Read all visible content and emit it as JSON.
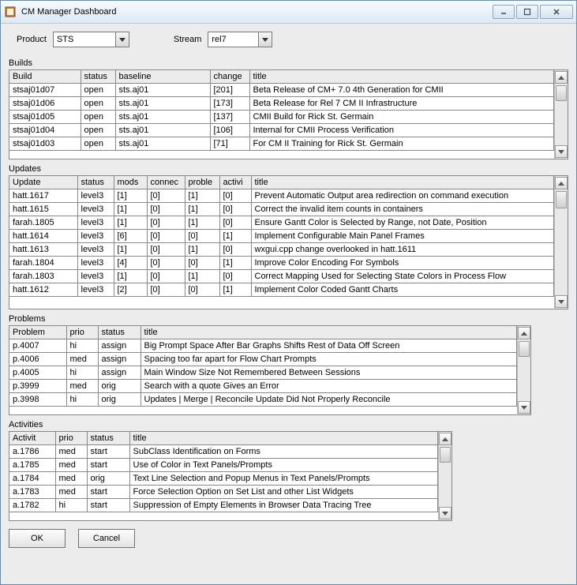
{
  "window": {
    "title": "CM Manager Dashboard"
  },
  "selectors": {
    "product_label": "Product",
    "product_value": "STS",
    "stream_label": "Stream",
    "stream_value": "rel7"
  },
  "builds": {
    "label": "Builds",
    "headers": [
      "Build",
      "status",
      "baseline",
      "change",
      "title"
    ],
    "rows": [
      {
        "c": [
          "stsaj01d07",
          "open",
          "sts.aj01",
          "[201]",
          "Beta Release of CM+ 7.0 4th Generation for CMII"
        ]
      },
      {
        "c": [
          "stsaj01d06",
          "open",
          "sts.aj01",
          "[173]",
          "Beta Release for Rel 7 CM II Infrastructure"
        ]
      },
      {
        "c": [
          "stsaj01d05",
          "open",
          "sts.aj01",
          "[137]",
          "CMII Build for Rick St. Germain"
        ]
      },
      {
        "c": [
          "stsaj01d04",
          "open",
          "sts.aj01",
          "[106]",
          "Internal for CMII Process Verification"
        ]
      },
      {
        "c": [
          "stsaj01d03",
          "open",
          "sts.aj01",
          "[71]",
          "For CM II Training for Rick St. Germain"
        ]
      }
    ]
  },
  "updates": {
    "label": "Updates",
    "headers": [
      "Update",
      "status",
      "mods",
      "connec",
      "proble",
      "activi",
      "title"
    ],
    "rows": [
      {
        "c": [
          "hatt.1617",
          "level3",
          "[1]",
          "[0]",
          "[1]",
          "[0]",
          "Prevent Automatic Output area redirection on command execution"
        ]
      },
      {
        "c": [
          "hatt.1615",
          "level3",
          "[1]",
          "[0]",
          "[1]",
          "[0]",
          "Correct the invalid item counts in containers"
        ]
      },
      {
        "c": [
          "farah.1805",
          "level3",
          "[1]",
          "[0]",
          "[1]",
          "[0]",
          "Ensure Gantt Color is Selected by Range, not Date, Position"
        ]
      },
      {
        "c": [
          "hatt.1614",
          "level3",
          "[6]",
          "[0]",
          "[0]",
          "[1]",
          "Implement Configurable Main Panel Frames"
        ]
      },
      {
        "c": [
          "hatt.1613",
          "level3",
          "[1]",
          "[0]",
          "[1]",
          "[0]",
          "wxgui.cpp change overlooked in hatt.1611"
        ]
      },
      {
        "c": [
          "farah.1804",
          "level3",
          "[4]",
          "[0]",
          "[0]",
          "[1]",
          "Improve Color Encoding For Symbols"
        ]
      },
      {
        "c": [
          "farah.1803",
          "level3",
          "[1]",
          "[0]",
          "[1]",
          "[0]",
          "Correct Mapping Used for Selecting State Colors in Process Flow"
        ]
      },
      {
        "c": [
          "hatt.1612",
          "level3",
          "[2]",
          "[0]",
          "[0]",
          "[1]",
          "Implement Color Coded Gantt Charts"
        ]
      }
    ]
  },
  "problems": {
    "label": "Problems",
    "headers": [
      "Problem",
      "prio",
      "status",
      "title"
    ],
    "rows": [
      {
        "c": [
          "p.4007",
          "hi",
          "assign",
          "Big Prompt Space After Bar Graphs Shifts Rest of Data Off Screen"
        ]
      },
      {
        "c": [
          "p.4006",
          "med",
          "assign",
          "Spacing too far apart for Flow Chart Prompts"
        ]
      },
      {
        "c": [
          "p.4005",
          "hi",
          "assign",
          "Main Window Size Not Remembered Between Sessions"
        ]
      },
      {
        "c": [
          "p.3999",
          "med",
          "orig",
          "Search with a quote Gives an Error"
        ]
      },
      {
        "c": [
          "p.3998",
          "hi",
          "orig",
          "Updates | Merge | Reconcile Update Did Not Properly Reconcile"
        ]
      }
    ]
  },
  "activities": {
    "label": "Activities",
    "headers": [
      "Activit",
      "prio",
      "status",
      "title"
    ],
    "rows": [
      {
        "c": [
          "a.1786",
          "med",
          "start",
          "SubClass Identification on Forms"
        ]
      },
      {
        "c": [
          "a.1785",
          "med",
          "start",
          "Use of Color in Text Panels/Prompts"
        ]
      },
      {
        "c": [
          "a.1784",
          "med",
          "orig",
          "Text Line Selection and Popup Menus in Text Panels/Prompts"
        ]
      },
      {
        "c": [
          "a.1783",
          "med",
          "start",
          "Force Selection Option on Set List and other List Widgets"
        ]
      },
      {
        "c": [
          "a.1782",
          "hi",
          "start",
          "Suppression of Empty Elements in Browser Data Tracing Tree"
        ]
      }
    ]
  },
  "buttons": {
    "ok": "OK",
    "cancel": "Cancel"
  }
}
